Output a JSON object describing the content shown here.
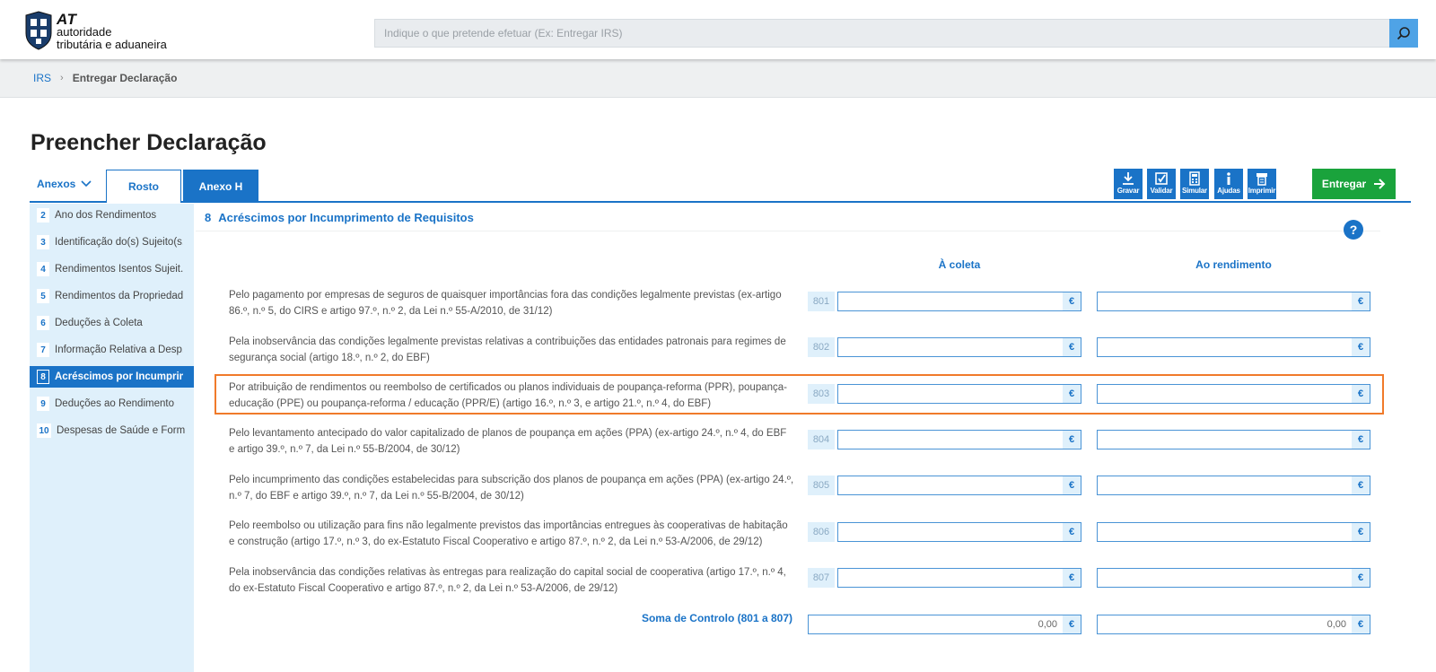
{
  "header": {
    "logo_abbr": "AT",
    "logo_line1": "autoridade",
    "logo_line2": "tributária e aduaneira",
    "search_placeholder": "Indique o que pretende efetuar (Ex: Entregar IRS)"
  },
  "breadcrumb": {
    "items": [
      "IRS",
      "Entregar Declaração"
    ],
    "separator": ">"
  },
  "page": {
    "title": "Preencher Declaração"
  },
  "tabs": {
    "anexos_label": "Anexos",
    "items": [
      {
        "label": "Rosto",
        "active": false
      },
      {
        "label": "Anexo H",
        "active": true
      }
    ]
  },
  "toolbar": {
    "buttons": [
      {
        "label": "Gravar",
        "icon": "download-icon"
      },
      {
        "label": "Validar",
        "icon": "checkbox-icon"
      },
      {
        "label": "Simular",
        "icon": "calculator-icon"
      },
      {
        "label": "Ajudas",
        "icon": "info-icon"
      },
      {
        "label": "Imprimir",
        "icon": "printer-icon"
      }
    ],
    "submit_label": "Entregar"
  },
  "sidebar": {
    "items": [
      {
        "num": "2",
        "label": "Ano dos Rendimentos"
      },
      {
        "num": "3",
        "label": "Identificação do(s) Sujeito(s..."
      },
      {
        "num": "4",
        "label": "Rendimentos Isentos Sujeit..."
      },
      {
        "num": "5",
        "label": "Rendimentos da Propriedad..."
      },
      {
        "num": "6",
        "label": "Deduções à Coleta"
      },
      {
        "num": "7",
        "label": "Informação Relativa a Desp..."
      },
      {
        "num": "8",
        "label": "Acréscimos por Incumprime..."
      },
      {
        "num": "9",
        "label": "Deduções ao Rendimento"
      },
      {
        "num": "10",
        "label": "Despesas de Saúde e Forma..."
      }
    ],
    "active_index": 6
  },
  "section": {
    "number": "8",
    "title": "Acréscimos por Incumprimento de Requisitos",
    "help": "?",
    "col_coleta": "À coleta",
    "col_rendimento": "Ao rendimento",
    "currency": "€",
    "rows": [
      {
        "code": "801",
        "text": "Pelo pagamento por empresas de seguros de quaisquer importâncias fora das condições legalmente previstas (ex-artigo 86.º, n.º 5, do CIRS e artigo 97.º, n.º 2, da Lei n.º 55-A/2010, de 31/12)",
        "coleta": "",
        "rendimento": ""
      },
      {
        "code": "802",
        "text": "Pela inobservância das condições legalmente previstas relativas a contribuições das entidades patronais para regimes de segurança social (artigo 18.º, n.º 2, do EBF)",
        "coleta": "",
        "rendimento": ""
      },
      {
        "code": "803",
        "text": "Por atribuição de rendimentos ou reembolso de certificados ou planos individuais de poupança-reforma (PPR), poupança-educação (PPE) ou poupança-reforma / educação (PPR/E) (artigo 16.º, n.º 3, e artigo 21.º, n.º 4, do EBF)",
        "coleta": "",
        "rendimento": ""
      },
      {
        "code": "804",
        "text": "Pelo levantamento antecipado do valor capitalizado de planos de poupança em ações (PPA) (ex-artigo 24.º, n.º 4, do EBF e artigo 39.º, n.º 7, da Lei n.º 55-B/2004, de 30/12)",
        "coleta": "",
        "rendimento": ""
      },
      {
        "code": "805",
        "text": "Pelo incumprimento das condições estabelecidas para subscrição dos planos de poupança em ações (PPA) (ex-artigo 24.º, n.º 7, do EBF e artigo 39.º, n.º 7, da Lei n.º 55-B/2004, de 30/12)",
        "coleta": "",
        "rendimento": ""
      },
      {
        "code": "806",
        "text": "Pelo reembolso ou utilização para fins não legalmente previstos das importâncias entregues às cooperativas de habitação e construção (artigo 17.º, n.º 3, do ex-Estatuto Fiscal Cooperativo e artigo 87.º, n.º 2, da Lei n.º 53-A/2006, de 29/12)",
        "coleta": "",
        "rendimento": ""
      },
      {
        "code": "807",
        "text": "Pela inobservância das condições relativas às entregas para realização do capital social de cooperativa (artigo 17.º, n.º 4, do ex-Estatuto Fiscal Cooperativo e artigo 87.º, n.º 2, da Lei n.º 53-A/2006, de 29/12)",
        "coleta": "",
        "rendimento": ""
      }
    ],
    "soma_label": "Soma de Controlo (801 a 807)",
    "soma_coleta": "0,00",
    "soma_rendimento": "0,00"
  },
  "colors": {
    "primary": "#1a73c7",
    "submit": "#1aa33c",
    "highlight": "#f07a2a",
    "sidebar_bg": "#dff0fb"
  }
}
